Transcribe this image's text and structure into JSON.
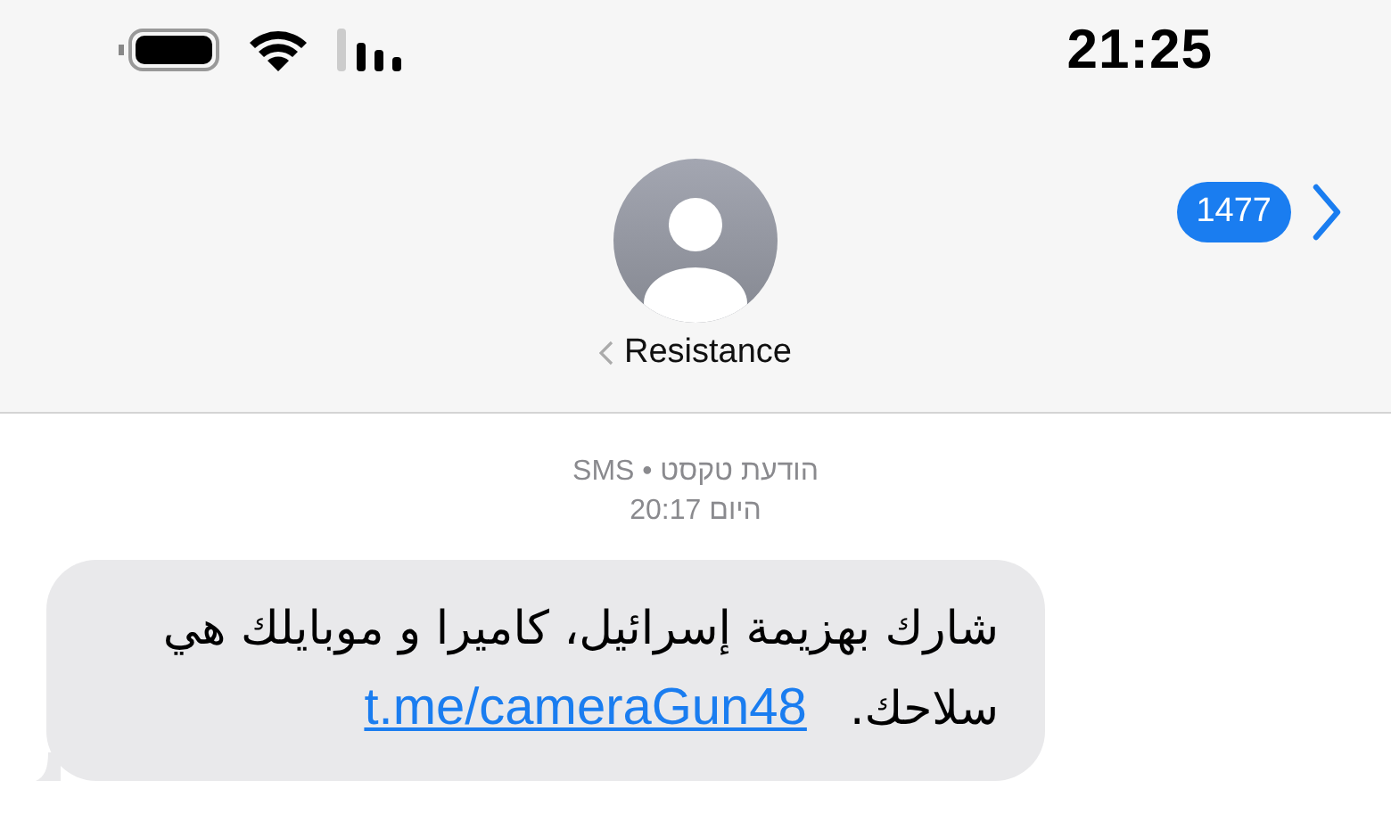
{
  "status_bar": {
    "time": "21:25"
  },
  "header": {
    "back_badge": "1477",
    "contact_name": "Resistance"
  },
  "messages": [
    {
      "meta": "הודעת טקסט • SMS",
      "timestamp": "היום 20:17",
      "text": "شارك بهزيمة إسرائيل، كاميرا و موبايلك هي سلاحك.",
      "link": "t.me/cameraGun48"
    }
  ]
}
